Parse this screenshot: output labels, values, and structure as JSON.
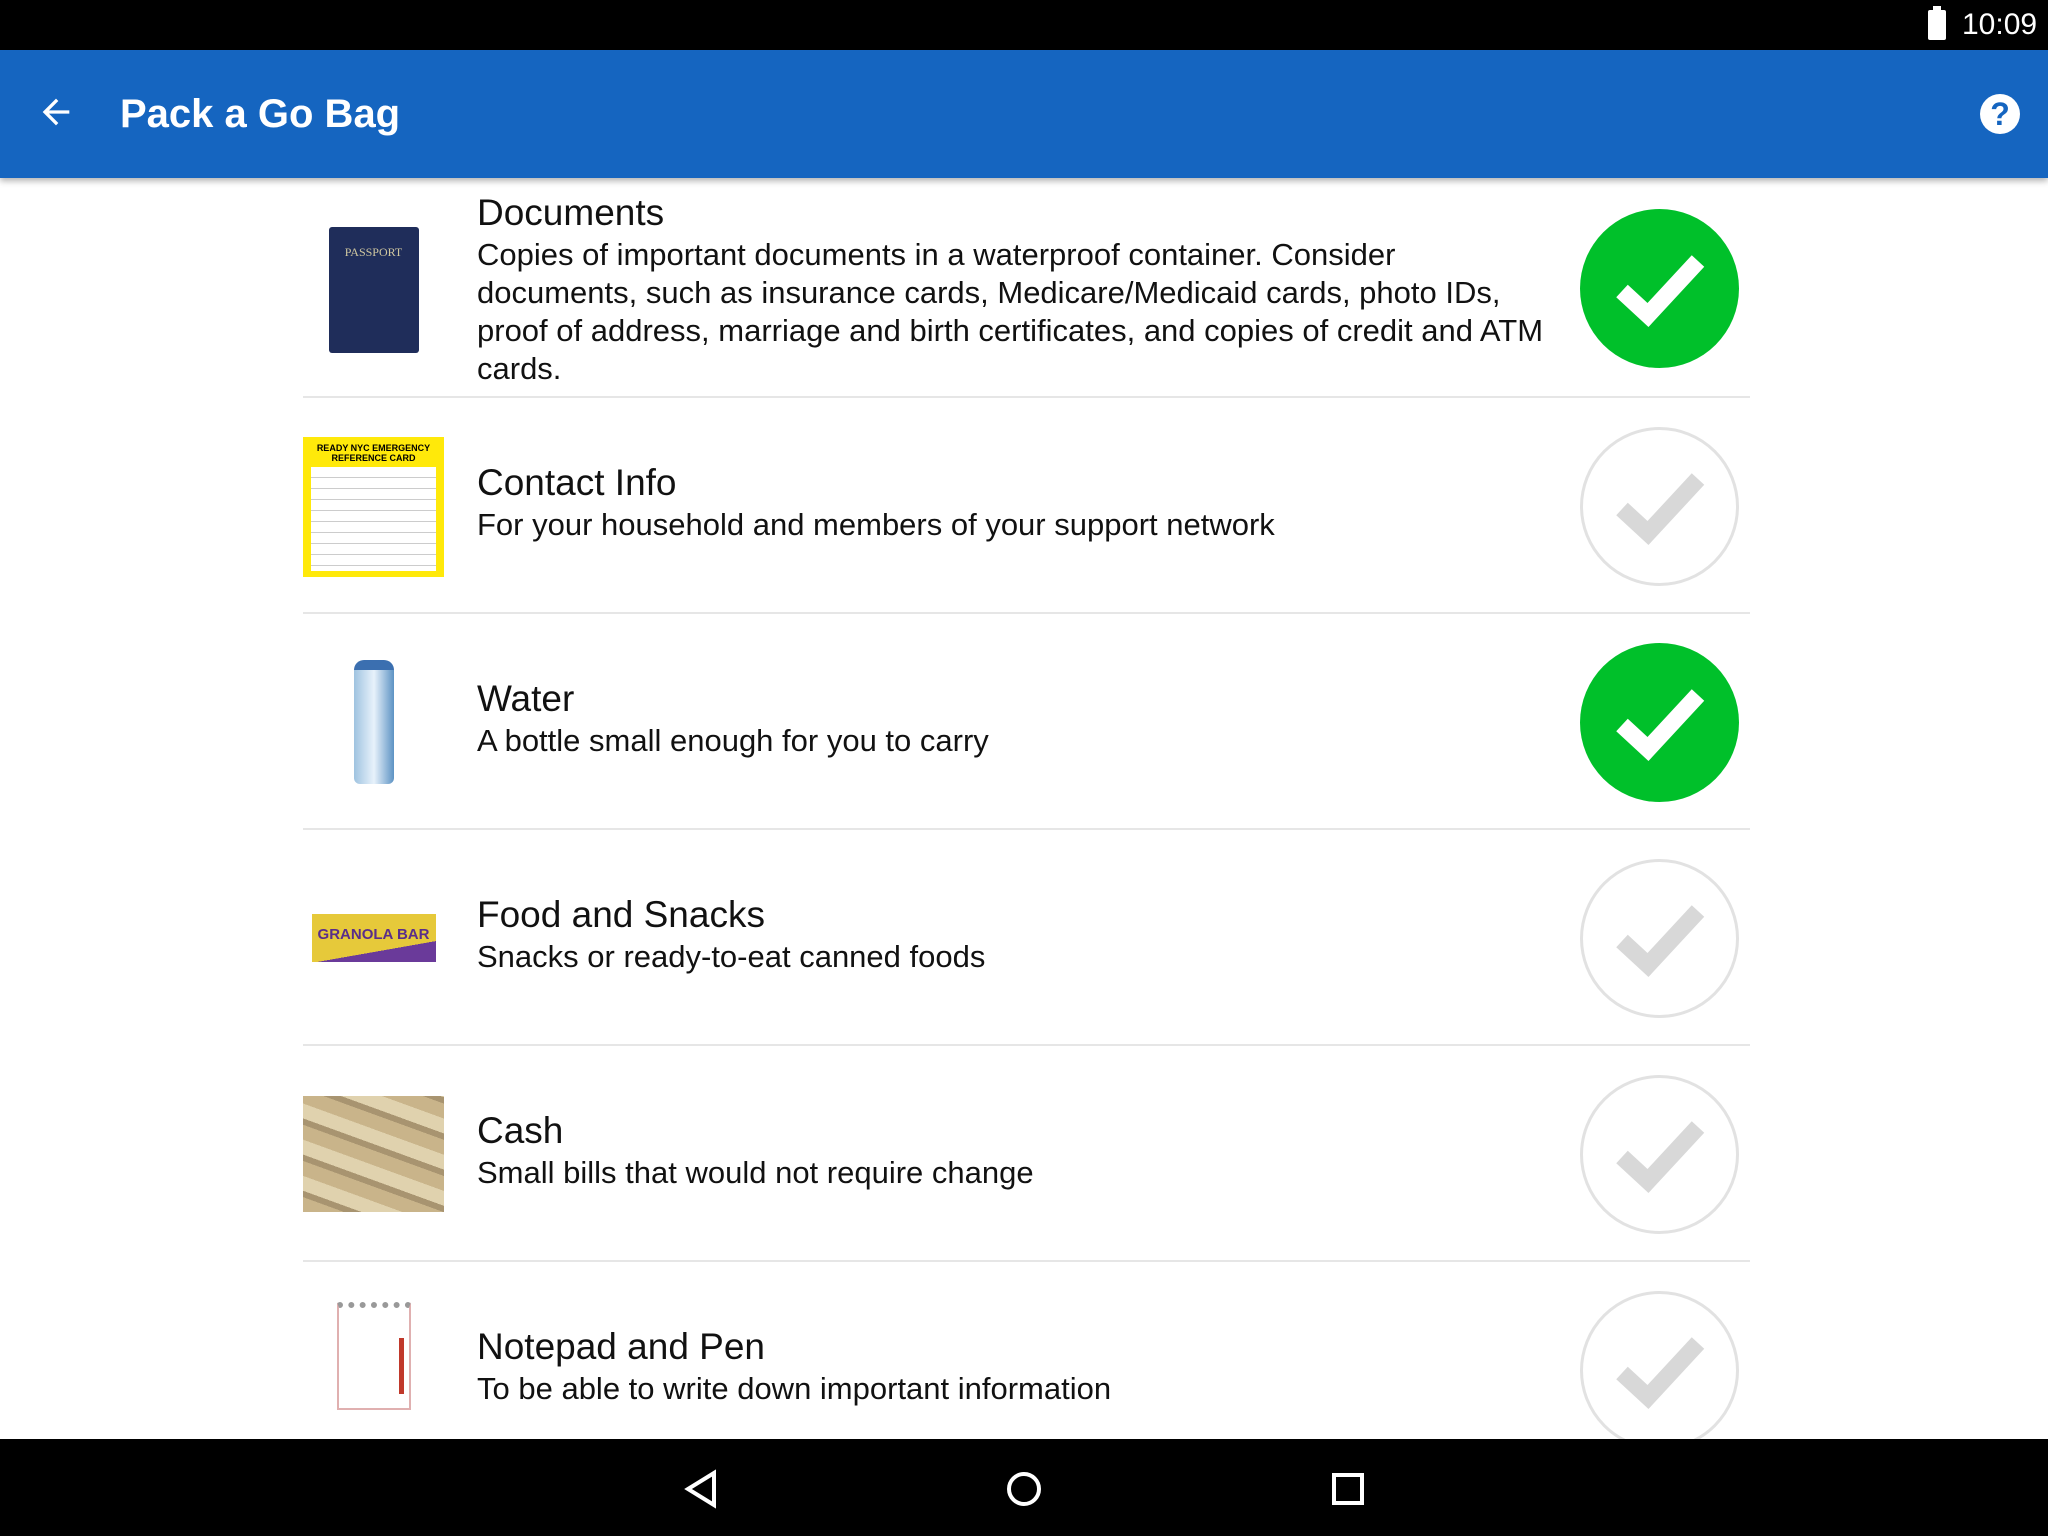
{
  "status_bar": {
    "time": "10:09"
  },
  "app_bar": {
    "title": "Pack a Go Bag",
    "back_icon": "arrow-back-icon",
    "help_icon": "help-icon"
  },
  "colors": {
    "app_bar": "#1565C0",
    "checked": "#00C02A",
    "unchecked_border": "#E2E2E2"
  },
  "items": [
    {
      "title": "Documents",
      "description": "Copies of important documents in a waterproof container. Consider documents, such as insurance cards, Medicare/Medicaid cards, photo IDs, proof of address, marriage and birth certificates, and copies of credit and ATM cards.",
      "checked": true,
      "image": "passport",
      "image_text": "PASSPORT"
    },
    {
      "title": "Contact Info",
      "description": "For your household and members of your support network",
      "checked": false,
      "image": "emergency-reference-card",
      "image_text": "READY NYC EMERGENCY REFERENCE CARD"
    },
    {
      "title": "Water",
      "description": "A bottle small enough for you to carry",
      "checked": true,
      "image": "water-bottle"
    },
    {
      "title": "Food and Snacks",
      "description": "Snacks or ready-to-eat canned foods",
      "checked": false,
      "image": "granola-bar",
      "image_text": "GRANOLA BAR"
    },
    {
      "title": "Cash",
      "description": "Small bills that would not require change",
      "checked": false,
      "image": "cash"
    },
    {
      "title": "Notepad and Pen",
      "description": "To be able to write down important information",
      "checked": false,
      "image": "notepad"
    }
  ]
}
